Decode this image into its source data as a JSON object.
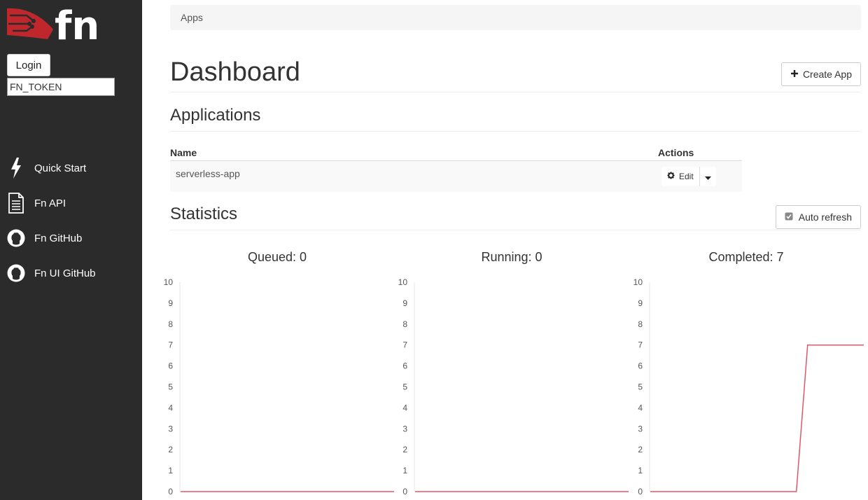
{
  "sidebar": {
    "logo_text": "fn",
    "login_label": "Login",
    "token_placeholder": "FN_TOKEN",
    "nav": [
      {
        "label": "Quick Start",
        "icon": "bolt-icon"
      },
      {
        "label": "Fn API",
        "icon": "document-icon"
      },
      {
        "label": "Fn GitHub",
        "icon": "github-icon"
      },
      {
        "label": "Fn UI GitHub",
        "icon": "github-icon"
      }
    ]
  },
  "breadcrumb": "Apps",
  "page_title": "Dashboard",
  "create_app_label": "Create App",
  "applications": {
    "title": "Applications",
    "columns": [
      "Name",
      "Actions"
    ],
    "rows": [
      {
        "name": "serverless-app",
        "action_label": "Edit"
      }
    ]
  },
  "statistics": {
    "title": "Statistics",
    "auto_refresh_label": "Auto refresh",
    "auto_refresh_checked": true
  },
  "colors": {
    "sidebar_bg": "#2b2b2b",
    "brand_red": "#c0272d",
    "line_color": "#e0566a"
  },
  "chart_data": [
    {
      "type": "line",
      "title": "Queued: 0",
      "ylim": [
        0,
        10
      ],
      "yticks": [
        0,
        1,
        2,
        3,
        4,
        5,
        6,
        7,
        8,
        9,
        10
      ],
      "series": [
        {
          "values": [
            0,
            0,
            0,
            0,
            0,
            0,
            0,
            0,
            0,
            0,
            0,
            0,
            0,
            0,
            0,
            0,
            0,
            0,
            0,
            0
          ]
        }
      ]
    },
    {
      "type": "line",
      "title": "Running: 0",
      "ylim": [
        0,
        10
      ],
      "yticks": [
        0,
        1,
        2,
        3,
        4,
        5,
        6,
        7,
        8,
        9,
        10
      ],
      "series": [
        {
          "values": [
            0,
            0,
            0,
            0,
            0,
            0,
            0,
            0,
            0,
            0,
            0,
            0,
            0,
            0,
            0,
            0,
            0,
            0,
            0,
            0
          ]
        }
      ]
    },
    {
      "type": "line",
      "title": "Completed: 7",
      "ylim": [
        0,
        10
      ],
      "yticks": [
        0,
        1,
        2,
        3,
        4,
        5,
        6,
        7,
        8,
        9,
        10
      ],
      "series": [
        {
          "values": [
            0,
            0,
            0,
            0,
            0,
            0,
            0,
            0,
            0,
            0,
            0,
            0,
            0,
            0,
            7,
            7,
            7,
            7,
            7,
            7
          ]
        }
      ]
    }
  ]
}
